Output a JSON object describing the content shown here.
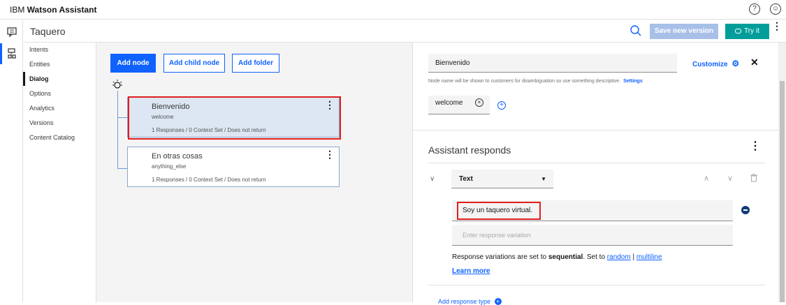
{
  "app": {
    "brand_prefix": "IBM ",
    "brand_name": "Watson Assistant"
  },
  "skill": {
    "title": "Taquero",
    "save_version_label": "Save new version",
    "try_it_label": "Try it"
  },
  "nav": {
    "items": [
      {
        "label": "Intents"
      },
      {
        "label": "Entities"
      },
      {
        "label": "Dialog",
        "active": true
      },
      {
        "label": "Options"
      },
      {
        "label": "Analytics"
      },
      {
        "label": "Versions"
      },
      {
        "label": "Content Catalog"
      }
    ]
  },
  "canvas": {
    "add_node_label": "Add node",
    "add_child_node_label": "Add child node",
    "add_folder_label": "Add folder",
    "nodes": [
      {
        "title": "Bienvenido",
        "condition": "welcome",
        "meta": "1 Responses / 0 Context Set / Does not return",
        "selected": true
      },
      {
        "title": "En otras cosas",
        "condition": "anything_else",
        "meta": "1 Responses / 0 Context Set / Does not return",
        "selected": false
      }
    ]
  },
  "editor": {
    "node_name": "Bienvenido",
    "customize_label": "Customize",
    "hint": "Node name will be shown to customers for disambiguation so use something descriptive.",
    "settings_link": "Settings",
    "condition_value": "welcome",
    "section_title": "Assistant responds",
    "response_type": "Text",
    "response_value": "Soy un taquero virtual.",
    "response_placeholder": "Enter response variation",
    "variation_prefix": "Response variations are set to ",
    "variation_mode": "sequential",
    "variation_mid": ". Set to ",
    "variation_random": "random",
    "variation_sep": " | ",
    "variation_multiline": "multiline",
    "learn_more": "Learn more",
    "add_response_type": "Add response type"
  },
  "colors": {
    "primary": "#0f62fe",
    "try_it": "#009d9a",
    "highlight": "#e01e1e",
    "selected_node": "#dce7f3"
  },
  "icons": [
    "help-icon",
    "user-icon",
    "chat-icon",
    "dialog-tree-icon",
    "search-icon",
    "gear-icon",
    "close-icon",
    "kebab-icon",
    "chevron-down-icon",
    "chevron-up-icon",
    "trash-icon",
    "add-circle-icon",
    "remove-circle-icon",
    "bulb-icon"
  ]
}
